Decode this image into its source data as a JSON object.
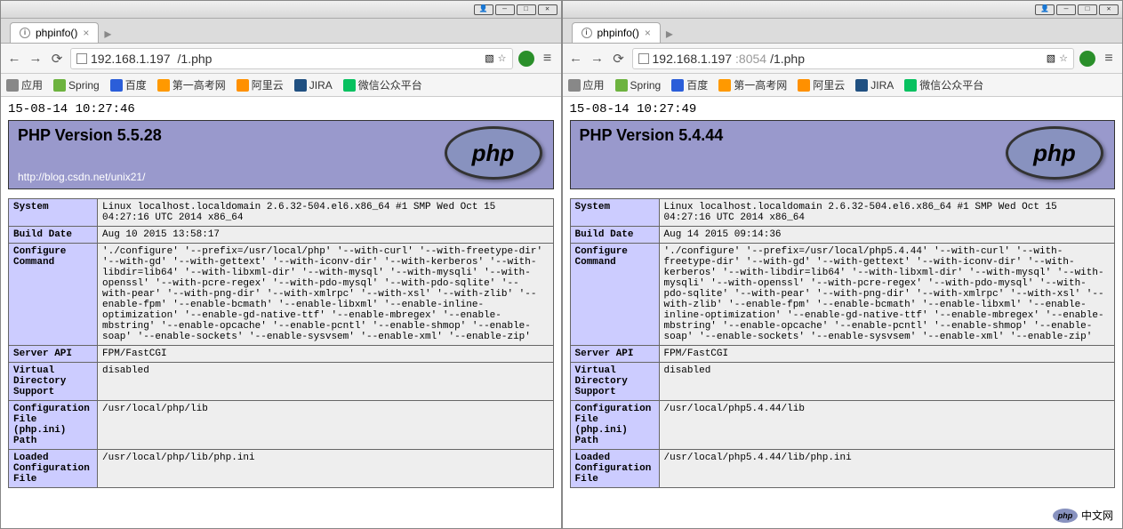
{
  "windows": [
    {
      "tab_title": "phpinfo()",
      "url_host": "192.168.1.197",
      "url_port": "",
      "url_path": "/1.php",
      "timestamp": "15-08-14 10:27:46",
      "php_version": "PHP Version 5.5.28",
      "blog_link": "http://blog.csdn.net/unix21/",
      "php_logo_text": "php",
      "rows": [
        {
          "k": "System",
          "v": "Linux localhost.localdomain 2.6.32-504.el6.x86_64 #1 SMP Wed Oct 15 04:27:16 UTC 2014 x86_64"
        },
        {
          "k": "Build Date",
          "v": "Aug 10 2015 13:58:17"
        },
        {
          "k": "Configure Command",
          "v": "'./configure' '--prefix=/usr/local/php' '--with-curl' '--with-freetype-dir' '--with-gd' '--with-gettext' '--with-iconv-dir' '--with-kerberos' '--with-libdir=lib64' '--with-libxml-dir' '--with-mysql' '--with-mysqli' '--with-openssl' '--with-pcre-regex' '--with-pdo-mysql' '--with-pdo-sqlite' '--with-pear' '--with-png-dir' '--with-xmlrpc' '--with-xsl' '--with-zlib' '--enable-fpm' '--enable-bcmath' '--enable-libxml' '--enable-inline-optimization' '--enable-gd-native-ttf' '--enable-mbregex' '--enable-mbstring' '--enable-opcache' '--enable-pcntl' '--enable-shmop' '--enable-soap' '--enable-sockets' '--enable-sysvsem' '--enable-xml' '--enable-zip'"
        },
        {
          "k": "Server API",
          "v": "FPM/FastCGI"
        },
        {
          "k": "Virtual Directory Support",
          "v": "disabled"
        },
        {
          "k": "Configuration File (php.ini) Path",
          "v": "/usr/local/php/lib"
        },
        {
          "k": "Loaded Configuration File",
          "v": "/usr/local/php/lib/php.ini"
        }
      ]
    },
    {
      "tab_title": "phpinfo()",
      "url_host": "192.168.1.197",
      "url_port": ":8054",
      "url_path": "/1.php",
      "timestamp": "15-08-14 10:27:49",
      "php_version": "PHP Version 5.4.44",
      "blog_link": "",
      "php_logo_text": "php",
      "rows": [
        {
          "k": "System",
          "v": "Linux localhost.localdomain 2.6.32-504.el6.x86_64 #1 SMP Wed Oct 15 04:27:16 UTC 2014 x86_64"
        },
        {
          "k": "Build Date",
          "v": "Aug 14 2015 09:14:36"
        },
        {
          "k": "Configure Command",
          "v": "'./configure' '--prefix=/usr/local/php5.4.44' '--with-curl' '--with-freetype-dir' '--with-gd' '--with-gettext' '--with-iconv-dir' '--with-kerberos' '--with-libdir=lib64' '--with-libxml-dir' '--with-mysql' '--with-mysqli' '--with-openssl' '--with-pcre-regex' '--with-pdo-mysql' '--with-pdo-sqlite' '--with-pear' '--with-png-dir' '--with-xmlrpc' '--with-xsl' '--with-zlib' '--enable-fpm' '--enable-bcmath' '--enable-libxml' '--enable-inline-optimization' '--enable-gd-native-ttf' '--enable-mbregex' '--enable-mbstring' '--enable-opcache' '--enable-pcntl' '--enable-shmop' '--enable-soap' '--enable-sockets' '--enable-sysvsem' '--enable-xml' '--enable-zip'"
        },
        {
          "k": "Server API",
          "v": "FPM/FastCGI"
        },
        {
          "k": "Virtual Directory Support",
          "v": "disabled"
        },
        {
          "k": "Configuration File (php.ini) Path",
          "v": "/usr/local/php5.4.44/lib"
        },
        {
          "k": "Loaded Configuration File",
          "v": "/usr/local/php5.4.44/lib/php.ini"
        }
      ]
    }
  ],
  "bookmarks": [
    {
      "ico": "i-apps",
      "label": "应用"
    },
    {
      "ico": "i-spring",
      "label": "Spring"
    },
    {
      "ico": "i-baidu",
      "label": "百度"
    },
    {
      "ico": "i-gaokao",
      "label": "第一高考网"
    },
    {
      "ico": "i-aliyun",
      "label": "阿里云"
    },
    {
      "ico": "i-jira",
      "label": "JIRA"
    },
    {
      "ico": "i-wx",
      "label": "微信公众平台"
    }
  ],
  "titlebar_buttons": [
    "👤",
    "—",
    "□",
    "✕"
  ],
  "watermark": {
    "logo": "php",
    "text": "中文网"
  }
}
